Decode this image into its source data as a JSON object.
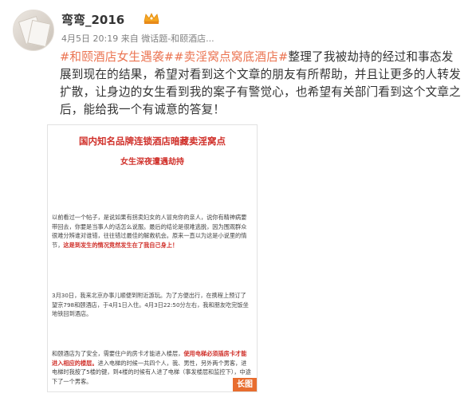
{
  "user": {
    "name": "弯弯_2016"
  },
  "meta": {
    "date": "4月5日 20:19",
    "from_label": "来自",
    "source": "微话题-和颐酒店..."
  },
  "post": {
    "tag1": "#和颐酒店女生遇袭#",
    "tag2": "#卖淫窝点窝底酒店#",
    "body": "整理了我被劫持的经过和事态发展到现在的结果，希望对看到这个文章的朋友有所帮助，并且让更多的人转发扩散，让身边的女生看到我的案子有警觉心，也希望有关部门看到这个文章之后，能给我一个有诚意的答复！"
  },
  "image": {
    "title1": "国内知名品牌连锁酒店暗藏卖淫窝点",
    "title2": "女生深夜遭遇劫持",
    "para1": "以前看过一个帖子，是说如果有拐卖妇女的人冒充你的亲人，说你有精神病要带回去，你要是当事人的话怎么说服。最后的结论是很难逃脱，因为围观群众很难分辨谁对谁错，往往错过最佳的解救机会。原来一直以为这是小说里的情节，",
    "para1_red": "这是到发生的情况竟然发生在了我自己身上！",
    "para2": "3月30日，我来北京办事儿顺便到附近游玩。为了方便出行，在携程上预订了望京798和颐酒店，于4月1日入住。4月3日22:50分左右，我和朋友吃完饭坐地铁回到酒店。",
    "para3": "和颐酒店为了安全，需要住户的房卡才能进入楼层，",
    "para3_red": "使用电梯必须插房卡才能进入相应的楼层。",
    "para3b": "进入电梯的时候一共四个人，我、男性，另外两个男客，进电梯时我按了5楼的键，到4楼的时候有人进了电梯（事发楼层和监控下），中途下了一个男客。",
    "long_badge": "长图"
  }
}
